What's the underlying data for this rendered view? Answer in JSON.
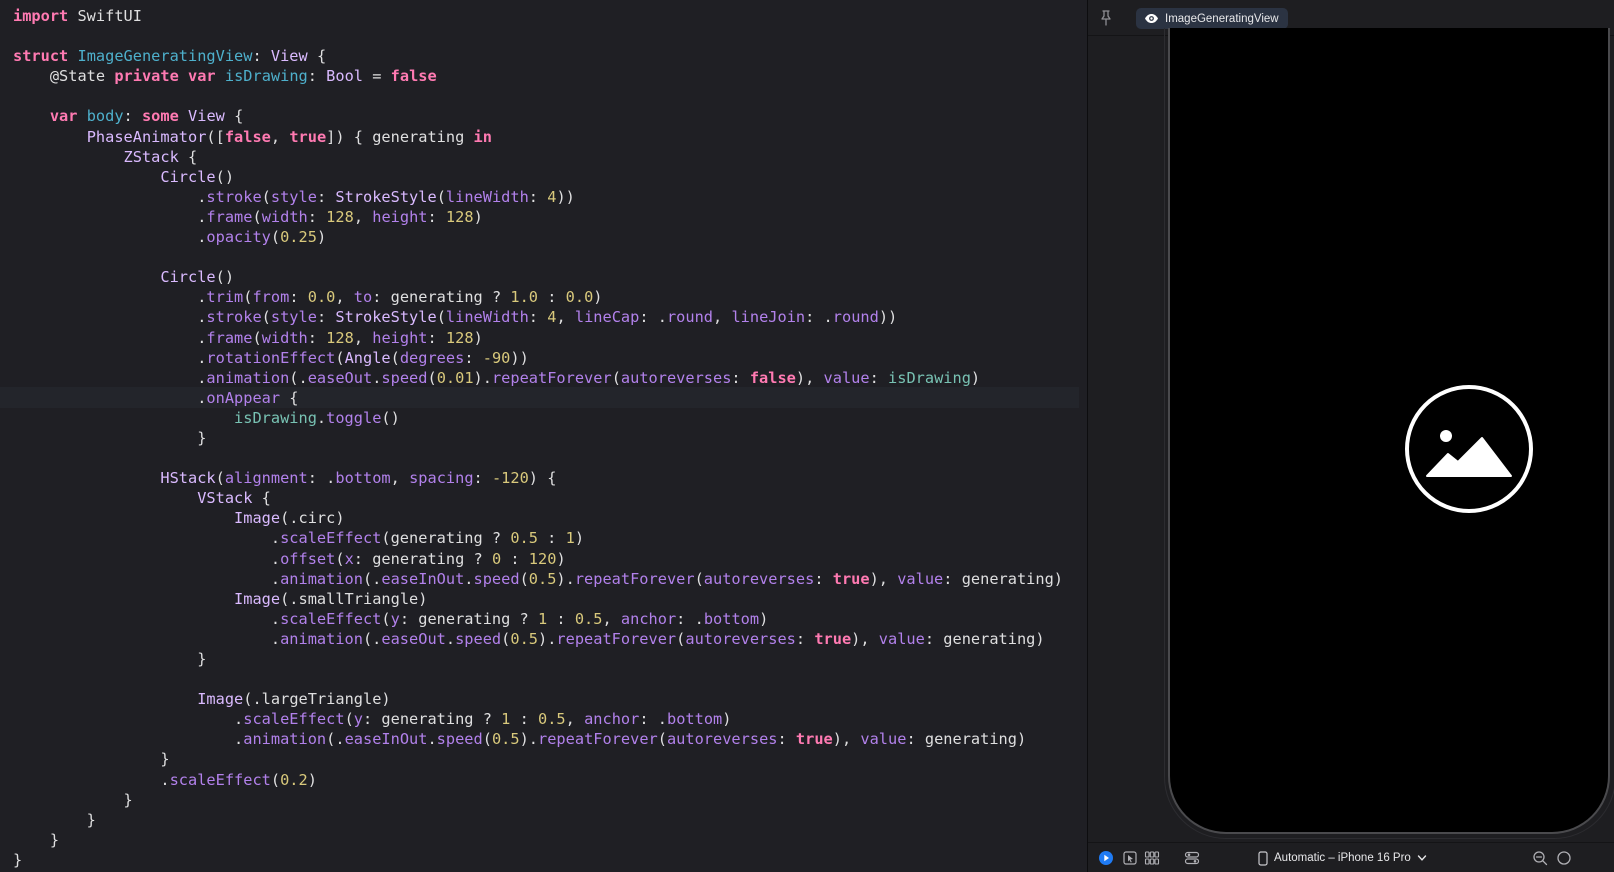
{
  "editor": {
    "lines": [
      [
        [
          "kw",
          "import"
        ],
        [
          "pl",
          " SwiftUI"
        ]
      ],
      [],
      [
        [
          "kw",
          "struct"
        ],
        [
          "pl",
          " "
        ],
        [
          "decl",
          "ImageGeneratingView"
        ],
        [
          "pl",
          ": "
        ],
        [
          "typ",
          "View"
        ],
        [
          "pl",
          " {"
        ]
      ],
      [
        [
          "pl",
          "    @State "
        ],
        [
          "kw",
          "private"
        ],
        [
          "pl",
          " "
        ],
        [
          "kw",
          "var"
        ],
        [
          "pl",
          " "
        ],
        [
          "decl",
          "isDrawing"
        ],
        [
          "pl",
          ": "
        ],
        [
          "typ",
          "Bool"
        ],
        [
          "pl",
          " = "
        ],
        [
          "kw",
          "false"
        ]
      ],
      [],
      [
        [
          "pl",
          "    "
        ],
        [
          "kw",
          "var"
        ],
        [
          "pl",
          " "
        ],
        [
          "decl",
          "body"
        ],
        [
          "pl",
          ": "
        ],
        [
          "kw",
          "some"
        ],
        [
          "pl",
          " "
        ],
        [
          "typ",
          "View"
        ],
        [
          "pl",
          " {"
        ]
      ],
      [
        [
          "pl",
          "        "
        ],
        [
          "typ",
          "PhaseAnimator"
        ],
        [
          "pl",
          "(["
        ],
        [
          "kw",
          "false"
        ],
        [
          "pl",
          ", "
        ],
        [
          "kw",
          "true"
        ],
        [
          "pl",
          "]) { generating "
        ],
        [
          "kw",
          "in"
        ]
      ],
      [
        [
          "pl",
          "            "
        ],
        [
          "typ",
          "ZStack"
        ],
        [
          "pl",
          " {"
        ]
      ],
      [
        [
          "pl",
          "                "
        ],
        [
          "typ",
          "Circle"
        ],
        [
          "pl",
          "()"
        ]
      ],
      [
        [
          "pl",
          "                    ."
        ],
        [
          "prop",
          "stroke"
        ],
        [
          "pl",
          "("
        ],
        [
          "prop",
          "style"
        ],
        [
          "pl",
          ": "
        ],
        [
          "typ",
          "StrokeStyle"
        ],
        [
          "pl",
          "("
        ],
        [
          "prop",
          "lineWidth"
        ],
        [
          "pl",
          ": "
        ],
        [
          "num",
          "4"
        ],
        [
          "pl",
          "))"
        ]
      ],
      [
        [
          "pl",
          "                    ."
        ],
        [
          "prop",
          "frame"
        ],
        [
          "pl",
          "("
        ],
        [
          "prop",
          "width"
        ],
        [
          "pl",
          ": "
        ],
        [
          "num",
          "128"
        ],
        [
          "pl",
          ", "
        ],
        [
          "prop",
          "height"
        ],
        [
          "pl",
          ": "
        ],
        [
          "num",
          "128"
        ],
        [
          "pl",
          ")"
        ]
      ],
      [
        [
          "pl",
          "                    ."
        ],
        [
          "prop",
          "opacity"
        ],
        [
          "pl",
          "("
        ],
        [
          "num",
          "0.25"
        ],
        [
          "pl",
          ")"
        ]
      ],
      [],
      [
        [
          "pl",
          "                "
        ],
        [
          "typ",
          "Circle"
        ],
        [
          "pl",
          "()"
        ]
      ],
      [
        [
          "pl",
          "                    ."
        ],
        [
          "prop",
          "trim"
        ],
        [
          "pl",
          "("
        ],
        [
          "prop",
          "from"
        ],
        [
          "pl",
          ": "
        ],
        [
          "num",
          "0.0"
        ],
        [
          "pl",
          ", "
        ],
        [
          "prop",
          "to"
        ],
        [
          "pl",
          ": generating ? "
        ],
        [
          "num",
          "1.0"
        ],
        [
          "pl",
          " : "
        ],
        [
          "num",
          "0.0"
        ],
        [
          "pl",
          ")"
        ]
      ],
      [
        [
          "pl",
          "                    ."
        ],
        [
          "prop",
          "stroke"
        ],
        [
          "pl",
          "("
        ],
        [
          "prop",
          "style"
        ],
        [
          "pl",
          ": "
        ],
        [
          "typ",
          "StrokeStyle"
        ],
        [
          "pl",
          "("
        ],
        [
          "prop",
          "lineWidth"
        ],
        [
          "pl",
          ": "
        ],
        [
          "num",
          "4"
        ],
        [
          "pl",
          ", "
        ],
        [
          "prop",
          "lineCap"
        ],
        [
          "pl",
          ": ."
        ],
        [
          "prop",
          "round"
        ],
        [
          "pl",
          ", "
        ],
        [
          "prop",
          "lineJoin"
        ],
        [
          "pl",
          ": ."
        ],
        [
          "prop",
          "round"
        ],
        [
          "pl",
          "))"
        ]
      ],
      [
        [
          "pl",
          "                    ."
        ],
        [
          "prop",
          "frame"
        ],
        [
          "pl",
          "("
        ],
        [
          "prop",
          "width"
        ],
        [
          "pl",
          ": "
        ],
        [
          "num",
          "128"
        ],
        [
          "pl",
          ", "
        ],
        [
          "prop",
          "height"
        ],
        [
          "pl",
          ": "
        ],
        [
          "num",
          "128"
        ],
        [
          "pl",
          ")"
        ]
      ],
      [
        [
          "pl",
          "                    ."
        ],
        [
          "prop",
          "rotationEffect"
        ],
        [
          "pl",
          "("
        ],
        [
          "typ",
          "Angle"
        ],
        [
          "pl",
          "("
        ],
        [
          "prop",
          "degrees"
        ],
        [
          "pl",
          ": "
        ],
        [
          "num",
          "-90"
        ],
        [
          "pl",
          "))"
        ]
      ],
      [
        [
          "pl",
          "                    ."
        ],
        [
          "prop",
          "animation"
        ],
        [
          "pl",
          "(."
        ],
        [
          "prop",
          "easeOut"
        ],
        [
          "pl",
          "."
        ],
        [
          "prop",
          "speed"
        ],
        [
          "pl",
          "("
        ],
        [
          "num",
          "0.01"
        ],
        [
          "pl",
          ")."
        ],
        [
          "prop",
          "repeatForever"
        ],
        [
          "pl",
          "("
        ],
        [
          "prop",
          "autoreverses"
        ],
        [
          "pl",
          ": "
        ],
        [
          "kw",
          "false"
        ],
        [
          "pl",
          "), "
        ],
        [
          "prop",
          "value"
        ],
        [
          "pl",
          ": "
        ],
        [
          "var",
          "isDrawing"
        ],
        [
          "pl",
          ")"
        ]
      ],
      [
        [
          "pl",
          "                    ."
        ],
        [
          "prop",
          "onAppear"
        ],
        [
          "pl",
          " {"
        ]
      ],
      [
        [
          "pl",
          "                        "
        ],
        [
          "var",
          "isDrawing"
        ],
        [
          "pl",
          "."
        ],
        [
          "prop",
          "toggle"
        ],
        [
          "pl",
          "()"
        ]
      ],
      [
        [
          "pl",
          "                    }"
        ]
      ],
      [],
      [
        [
          "pl",
          "                "
        ],
        [
          "typ",
          "HStack"
        ],
        [
          "pl",
          "("
        ],
        [
          "prop",
          "alignment"
        ],
        [
          "pl",
          ": ."
        ],
        [
          "prop",
          "bottom"
        ],
        [
          "pl",
          ", "
        ],
        [
          "prop",
          "spacing"
        ],
        [
          "pl",
          ": "
        ],
        [
          "num",
          "-120"
        ],
        [
          "pl",
          ") {"
        ]
      ],
      [
        [
          "pl",
          "                    "
        ],
        [
          "typ",
          "VStack"
        ],
        [
          "pl",
          " {"
        ]
      ],
      [
        [
          "pl",
          "                        "
        ],
        [
          "typ",
          "Image"
        ],
        [
          "pl",
          "(.circ)"
        ]
      ],
      [
        [
          "pl",
          "                            ."
        ],
        [
          "prop",
          "scaleEffect"
        ],
        [
          "pl",
          "(generating ? "
        ],
        [
          "num",
          "0.5"
        ],
        [
          "pl",
          " : "
        ],
        [
          "num",
          "1"
        ],
        [
          "pl",
          ")"
        ]
      ],
      [
        [
          "pl",
          "                            ."
        ],
        [
          "prop",
          "offset"
        ],
        [
          "pl",
          "("
        ],
        [
          "prop",
          "x"
        ],
        [
          "pl",
          ": generating ? "
        ],
        [
          "num",
          "0"
        ],
        [
          "pl",
          " : "
        ],
        [
          "num",
          "120"
        ],
        [
          "pl",
          ")"
        ]
      ],
      [
        [
          "pl",
          "                            ."
        ],
        [
          "prop",
          "animation"
        ],
        [
          "pl",
          "(."
        ],
        [
          "prop",
          "easeInOut"
        ],
        [
          "pl",
          "."
        ],
        [
          "prop",
          "speed"
        ],
        [
          "pl",
          "("
        ],
        [
          "num",
          "0.5"
        ],
        [
          "pl",
          ")."
        ],
        [
          "prop",
          "repeatForever"
        ],
        [
          "pl",
          "("
        ],
        [
          "prop",
          "autoreverses"
        ],
        [
          "pl",
          ": "
        ],
        [
          "kw",
          "true"
        ],
        [
          "pl",
          "), "
        ],
        [
          "prop",
          "value"
        ],
        [
          "pl",
          ": generating)"
        ]
      ],
      [
        [
          "pl",
          "                        "
        ],
        [
          "typ",
          "Image"
        ],
        [
          "pl",
          "(.smallTriangle)"
        ]
      ],
      [
        [
          "pl",
          "                            ."
        ],
        [
          "prop",
          "scaleEffect"
        ],
        [
          "pl",
          "("
        ],
        [
          "prop",
          "y"
        ],
        [
          "pl",
          ": generating ? "
        ],
        [
          "num",
          "1"
        ],
        [
          "pl",
          " : "
        ],
        [
          "num",
          "0.5"
        ],
        [
          "pl",
          ", "
        ],
        [
          "prop",
          "anchor"
        ],
        [
          "pl",
          ": ."
        ],
        [
          "prop",
          "bottom"
        ],
        [
          "pl",
          ")"
        ]
      ],
      [
        [
          "pl",
          "                            ."
        ],
        [
          "prop",
          "animation"
        ],
        [
          "pl",
          "(."
        ],
        [
          "prop",
          "easeOut"
        ],
        [
          "pl",
          "."
        ],
        [
          "prop",
          "speed"
        ],
        [
          "pl",
          "("
        ],
        [
          "num",
          "0.5"
        ],
        [
          "pl",
          ")."
        ],
        [
          "prop",
          "repeatForever"
        ],
        [
          "pl",
          "("
        ],
        [
          "prop",
          "autoreverses"
        ],
        [
          "pl",
          ": "
        ],
        [
          "kw",
          "true"
        ],
        [
          "pl",
          "), "
        ],
        [
          "prop",
          "value"
        ],
        [
          "pl",
          ": generating)"
        ]
      ],
      [
        [
          "pl",
          "                    }"
        ]
      ],
      [],
      [
        [
          "pl",
          "                    "
        ],
        [
          "typ",
          "Image"
        ],
        [
          "pl",
          "(.largeTriangle)"
        ]
      ],
      [
        [
          "pl",
          "                        ."
        ],
        [
          "prop",
          "scaleEffect"
        ],
        [
          "pl",
          "("
        ],
        [
          "prop",
          "y"
        ],
        [
          "pl",
          ": generating ? "
        ],
        [
          "num",
          "1"
        ],
        [
          "pl",
          " : "
        ],
        [
          "num",
          "0.5"
        ],
        [
          "pl",
          ", "
        ],
        [
          "prop",
          "anchor"
        ],
        [
          "pl",
          ": ."
        ],
        [
          "prop",
          "bottom"
        ],
        [
          "pl",
          ")"
        ]
      ],
      [
        [
          "pl",
          "                        ."
        ],
        [
          "prop",
          "animation"
        ],
        [
          "pl",
          "(."
        ],
        [
          "prop",
          "easeInOut"
        ],
        [
          "pl",
          "."
        ],
        [
          "prop",
          "speed"
        ],
        [
          "pl",
          "("
        ],
        [
          "num",
          "0.5"
        ],
        [
          "pl",
          ")."
        ],
        [
          "prop",
          "repeatForever"
        ],
        [
          "pl",
          "("
        ],
        [
          "prop",
          "autoreverses"
        ],
        [
          "pl",
          ": "
        ],
        [
          "kw",
          "true"
        ],
        [
          "pl",
          "), "
        ],
        [
          "prop",
          "value"
        ],
        [
          "pl",
          ": generating)"
        ]
      ],
      [
        [
          "pl",
          "                }"
        ]
      ],
      [
        [
          "pl",
          "                ."
        ],
        [
          "prop",
          "scaleEffect"
        ],
        [
          "pl",
          "("
        ],
        [
          "num",
          "0.2"
        ],
        [
          "pl",
          ")"
        ]
      ],
      [
        [
          "pl",
          "            }"
        ]
      ],
      [
        [
          "pl",
          "        }"
        ]
      ],
      [
        [
          "pl",
          "    }"
        ]
      ],
      [
        [
          "pl",
          "}"
        ]
      ]
    ]
  },
  "preview": {
    "tab_label": "ImageGeneratingView",
    "device_label": "Automatic – iPhone 16 Pro",
    "icons": {
      "pin": "pin-icon",
      "eye": "eye-icon",
      "photo": "photo-icon",
      "live": "live-preview-icon",
      "select": "selectable-icon",
      "variants": "variants-grid-icon",
      "settings": "device-settings-icon",
      "phone": "iphone-icon",
      "chevron": "chevron-down-icon",
      "zoom_out": "zoom-out-icon",
      "zoom_fit": "zoom-fit-icon"
    },
    "colors": {
      "accent": "#1f7bf4",
      "editor_bg": "#1f1f24",
      "keyword": "#ff7ab2",
      "type": "#dabaff",
      "property": "#b281eb",
      "number": "#d9c97c",
      "declaration": "#4eb0cc"
    }
  }
}
